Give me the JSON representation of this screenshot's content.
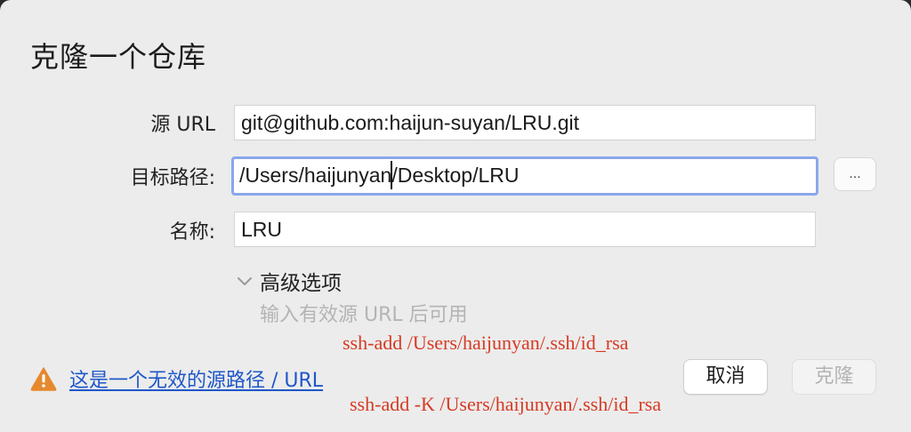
{
  "dialog": {
    "title": "克隆一个仓库"
  },
  "form": {
    "source_url": {
      "label": "源 URL",
      "value": "git@github.com:haijun-suyan/LRU.git"
    },
    "target_path": {
      "label": "目标路径:",
      "value_before_caret": "/Users/haijunyan",
      "value_after_caret": "/Desktop/LRU",
      "browse_label": "..."
    },
    "name": {
      "label": "名称:",
      "value": "LRU"
    }
  },
  "advanced": {
    "label": "高级选项",
    "hint": "输入有效源 URL 后可用",
    "icon": "chevron-down-icon"
  },
  "annotations": {
    "line1": "ssh-add /Users/haijunyan/.ssh/id_rsa",
    "line2": "ssh-add -K /Users/haijunyan/.ssh/id_rsa",
    "color": "#d63a23"
  },
  "error": {
    "icon": "warning-icon",
    "message": "这是一个无效的源路径 / URL",
    "icon_color": "#e6892e",
    "link_color": "#1f57c9"
  },
  "buttons": {
    "cancel": "取消",
    "clone": "克隆"
  },
  "colors": {
    "dialog_bg": "#ececec",
    "focus_ring": "#8aa7eb"
  }
}
